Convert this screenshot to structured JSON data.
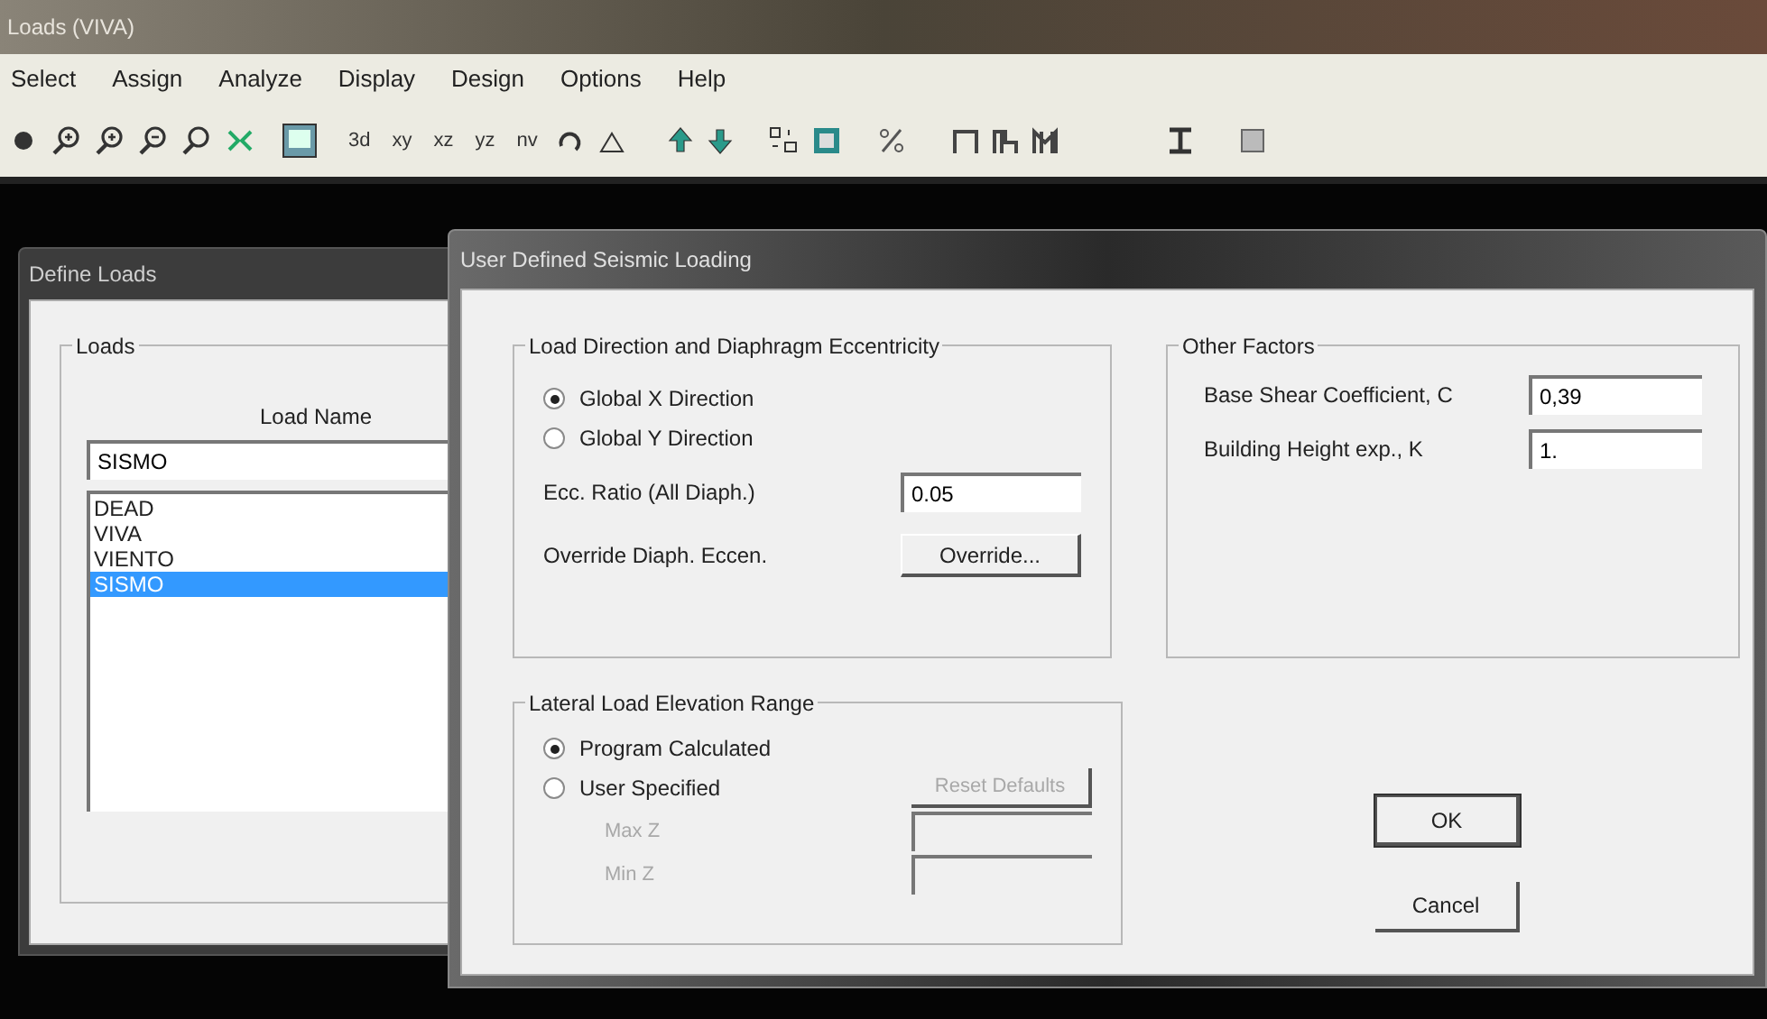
{
  "window": {
    "title": "Loads (VIVA)"
  },
  "menu": [
    "Select",
    "Assign",
    "Analyze",
    "Display",
    "Design",
    "Options",
    "Help"
  ],
  "toolbar": {
    "view_buttons": [
      "3d",
      "xy",
      "xz",
      "yz",
      "nv"
    ]
  },
  "define_loads": {
    "title": "Define Loads",
    "group": "Loads",
    "column": "Load Name",
    "value": "SISMO",
    "items": [
      {
        "label": "DEAD",
        "selected": false
      },
      {
        "label": "VIVA",
        "selected": false
      },
      {
        "label": "VIENTO",
        "selected": false
      },
      {
        "label": "SISMO",
        "selected": true
      }
    ]
  },
  "seismic_dialog": {
    "title": "User Defined Seismic Loading",
    "direction_group": {
      "title": "Load Direction and Diaphragm Eccentricity",
      "options": [
        {
          "label": "Global X Direction",
          "selected": true
        },
        {
          "label": "Global Y Direction",
          "selected": false
        }
      ],
      "ecc_label": "Ecc. Ratio (All Diaph.)",
      "ecc_value": "0.05",
      "override_label": "Override Diaph. Eccen.",
      "override_button": "Override..."
    },
    "elevation_group": {
      "title": "Lateral Load Elevation Range",
      "options": [
        {
          "label": "Program Calculated",
          "selected": true
        },
        {
          "label": "User Specified",
          "selected": false
        }
      ],
      "reset_button": {
        "label": "Reset Defaults",
        "disabled": true
      },
      "fields": [
        {
          "label": "Max Z",
          "disabled": true
        },
        {
          "label": "Min Z",
          "disabled": true
        }
      ]
    },
    "other_factors": {
      "title": "Other Factors",
      "rows": [
        {
          "label": "Base Shear Coefficient, C",
          "value": "0,39"
        },
        {
          "label": "Building Height exp., K",
          "value": "1."
        }
      ]
    },
    "buttons": [
      {
        "label": "OK",
        "default": true
      },
      {
        "label": "Cancel",
        "default": false
      }
    ]
  }
}
